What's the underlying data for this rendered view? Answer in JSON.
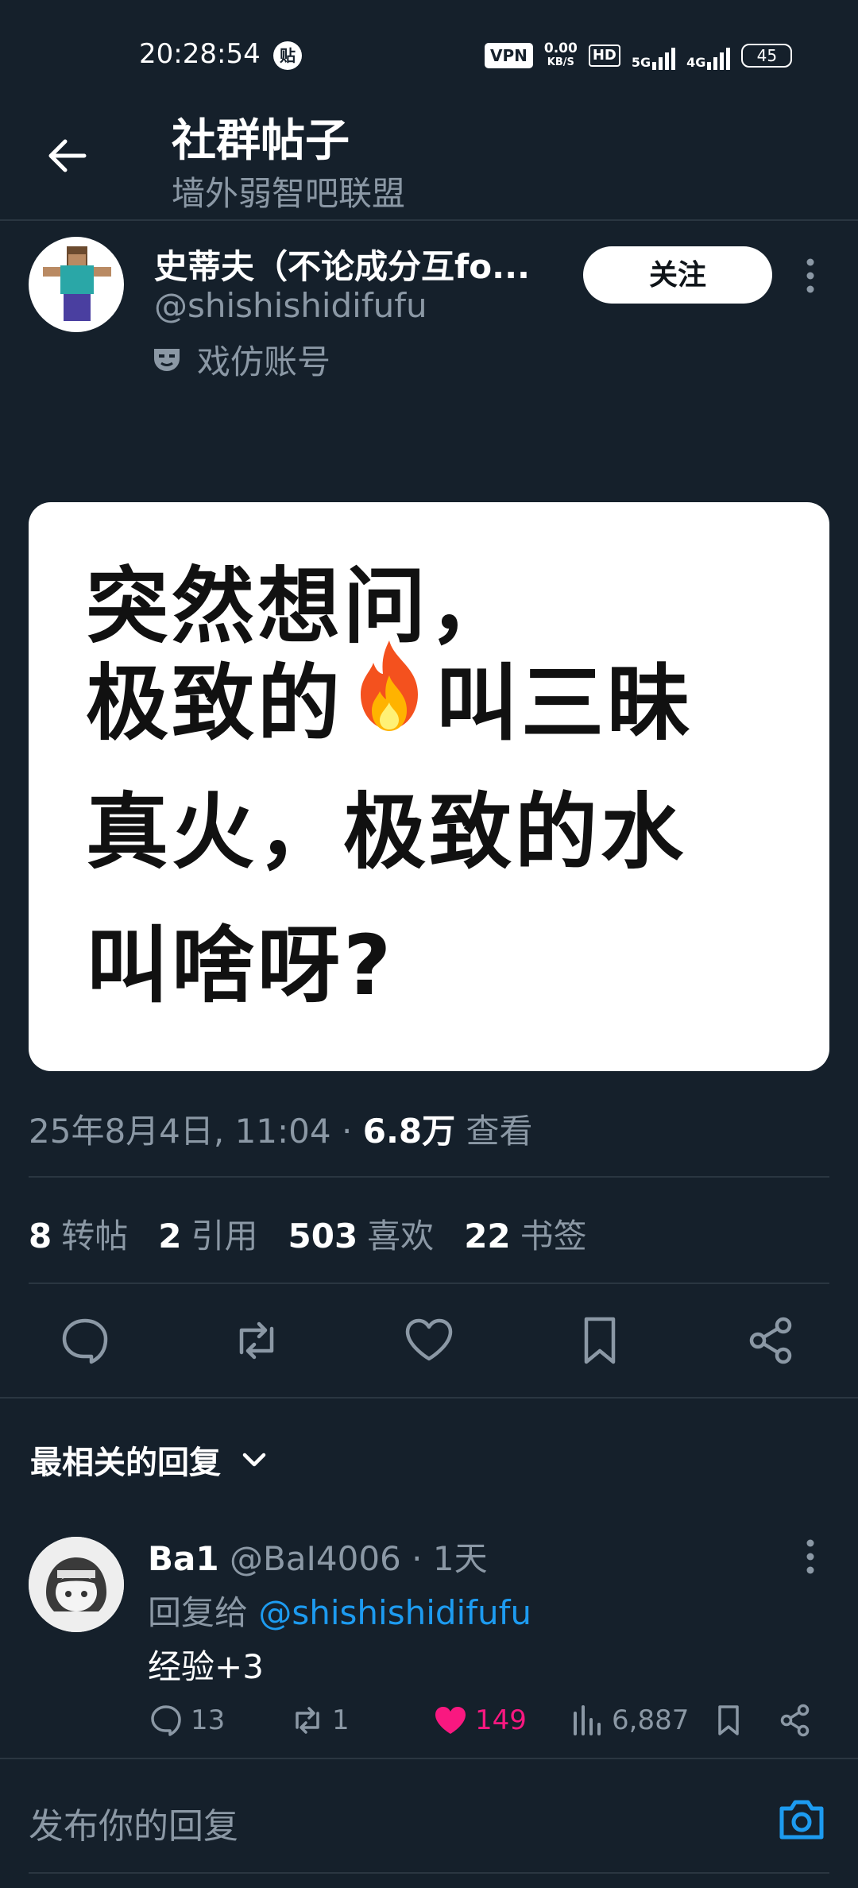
{
  "status_bar": {
    "time": "20:28:54",
    "app_badge": "贴",
    "vpn": "VPN",
    "net_speed_value": "0.00",
    "net_speed_unit": "KB/S",
    "hd": "HD",
    "signal1": "5G",
    "signal2": "4G",
    "battery": "45"
  },
  "header": {
    "title": "社群帖子",
    "subtitle": "墙外弱智吧联盟"
  },
  "author": {
    "name": "史蒂夫（不论成分互fo...",
    "handle": "@shishishidifufu",
    "parody_label": "戏仿账号",
    "follow_label": "关注"
  },
  "post_image": {
    "line1": "突然想问，",
    "line2a": "极致的",
    "line2b": "叫三昧",
    "line3": "真火，极致的水",
    "line4": "叫啥呀?"
  },
  "meta": {
    "date": "25年8月4日, 11:04",
    "separator": "·",
    "views": "6.8万",
    "views_label": "查看"
  },
  "stats": {
    "reposts": "8",
    "reposts_label": "转帖",
    "quotes": "2",
    "quotes_label": "引用",
    "likes": "503",
    "likes_label": "喜欢",
    "bookmarks": "22",
    "bookmarks_label": "书签"
  },
  "replies_header": "最相关的回复",
  "reply": {
    "name": "Ba1",
    "handle": "@BaI4006",
    "separator": "·",
    "time": "1天",
    "reply_to_prefix": "回复给",
    "reply_to_handle": "@shishishidifufu",
    "text": "经验+3",
    "replies": "13",
    "reposts": "1",
    "likes": "149",
    "views": "6,887"
  },
  "compose": {
    "placeholder": "发布你的回复"
  },
  "colors": {
    "background": "#15202b",
    "accent": "#1d9bf0",
    "like": "#f91880",
    "muted": "#8b98a5"
  }
}
